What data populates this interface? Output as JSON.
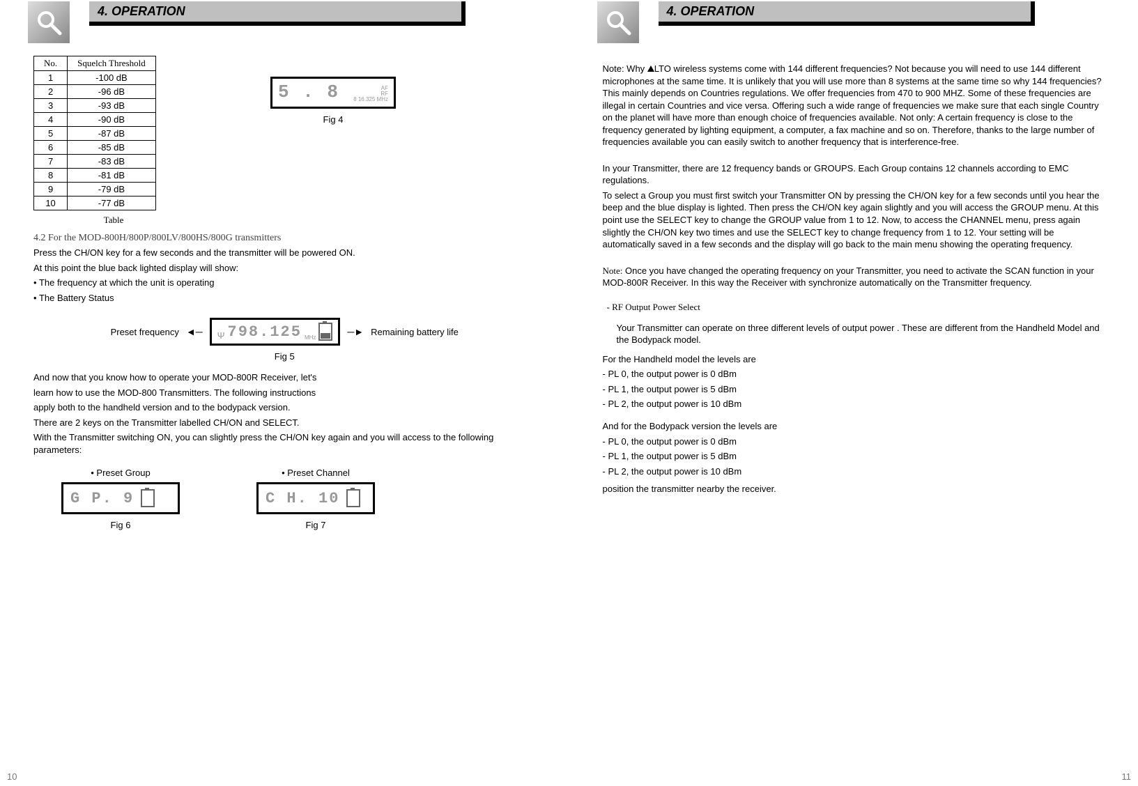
{
  "left": {
    "section_title": "4. OPERATION",
    "table": {
      "head_no": "No.",
      "head_thresh": "Squelch Threshold",
      "caption": "Table",
      "rows": [
        {
          "no": "1",
          "val": "-100 dB"
        },
        {
          "no": "2",
          "val": "-96 dB"
        },
        {
          "no": "3",
          "val": "-93 dB"
        },
        {
          "no": "4",
          "val": "-90 dB"
        },
        {
          "no": "5",
          "val": "-87 dB"
        },
        {
          "no": "6",
          "val": "-85 dB"
        },
        {
          "no": "7",
          "val": "-83 dB"
        },
        {
          "no": "8",
          "val": "-81 dB"
        },
        {
          "no": "9",
          "val": "-79 dB"
        },
        {
          "no": "10",
          "val": "-77 dB"
        }
      ]
    },
    "fig4": {
      "display": "5 . 8",
      "sub1": "AF",
      "sub2": "RF",
      "sub3": "8 16.325 MHz",
      "caption": "Fig 4"
    },
    "subhead": "4.2 For the MOD-800H/800P/800LV/800HS/800G transmitters",
    "p1": "Press the CH/ON key for a few seconds and the transmitter will be powered ON.",
    "p2": "At this point the blue back lighted display will show:",
    "b1": "The frequency at which the unit is operating",
    "b2": "The Battery Status",
    "fig5": {
      "left_label": "Preset frequency",
      "display": "798.125",
      "unit": "MHz",
      "right_label": "Remaining battery life",
      "caption": "Fig 5"
    },
    "p3": "And now that you know how to operate your MOD-800R Receiver, let's",
    "p4": "learn how to use the MOD-800 Transmitters. The following instructions",
    "p5": "apply both to the handheld version and to the bodypack version.",
    "p6": "There are 2 keys on the Transmitter labelled CH/ON and SELECT.",
    "p7": "With the Transmitter switching ON, you can slightly press the CH/ON key again and you will access to the following parameters:",
    "fig6": {
      "label": "Preset Group",
      "display": "G P.  9",
      "caption": "Fig 6"
    },
    "fig7": {
      "label": "Preset Channel",
      "display": "C H. 10",
      "caption": "Fig 7"
    },
    "page_num": "10"
  },
  "right": {
    "section_title": "4. OPERATION",
    "note_head": "Note: Why ",
    "note_tail": "LTO wireless systems come with 144 different frequencies? Not because you will need to use 144 different microphones at the same time. It is unlikely that you will use more than 8 systems at the same time so why 144 frequencies? This mainly depends on Countries regulations. We offer frequencies from 470 to 900 MHZ. Some of these frequencies are illegal in certain Countries and vice versa. Offering such a wide range of frequencies we make sure that each single Country on the planet will have more than enough choice of frequencies available. Not only: A certain frequency is close to the frequency generated by lighting equipment, a computer, a fax machine and so on. Therefore, thanks to the large number of frequencies available you can easily switch to another frequency that is interference-free.",
    "grp1": "In your Transmitter, there are 12 frequency bands or GROUPS. Each Group contains 12 channels according to EMC regulations.",
    "grp2": "To select a Group you must first switch your Transmitter ON by pressing the CH/ON key for a few seconds until you hear the beep and the blue display is lighted. Then press the CH/ON key again slightly and you will access the GROUP menu. At this point use the SELECT key to change the GROUP value from 1 to 12. Now, to access the CHANNEL menu, press again slightly the CH/ON key two times and use the SELECT key to change frequency from 1 to 12. Your setting will be automatically saved in a few seconds and the display will go back to the main menu showing the operating frequency.",
    "note2_label": "Note:",
    "note2_body": " Once you have changed the operating frequency on your Transmitter, you need to activate the SCAN function in your MOD-800R Receiver. In this way the Receiver with synchronize automatically on the Transmitter frequency.",
    "rf_head": "- RF Output Power Select",
    "rf_body": "Your Transmitter can operate on three different levels of output power . These are different from the Handheld Model and the Bodypack model.",
    "hand_head": "For the Handheld model the levels are",
    "hand_l0": "- PL 0, the output power is 0 dBm",
    "hand_l1": "- PL 1, the output power is 5 dBm",
    "hand_l2": "- PL 2, the output power is 10 dBm",
    "body_head": "And for the Bodypack version the levels are",
    "body_l0": "- PL 0, the output power is 0 dBm",
    "body_l1": "- PL 1, the output power is 5 dBm",
    "body_l2": "- PL 2, the output power is 10 dBm",
    "trailer": "position the transmitter nearby the receiver.",
    "page_num": "11"
  }
}
